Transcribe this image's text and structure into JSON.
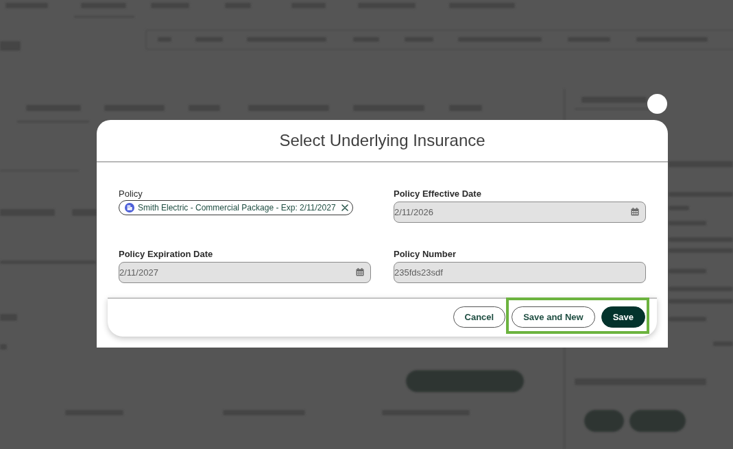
{
  "dialog": {
    "title": "Select Underlying Insurance",
    "fields": [
      {
        "kind": "chip",
        "label": "Policy",
        "value": "Smith Electric - Commercial Package - Exp: 2/11/2027"
      },
      {
        "kind": "date",
        "label": "Policy Effective Date",
        "value": "2/11/2026"
      },
      {
        "kind": "date",
        "label": "Policy Expiration Date",
        "value": "2/11/2027"
      },
      {
        "kind": "text",
        "label": "Policy Number",
        "value": "235fds23sdf"
      }
    ],
    "buttons": [
      {
        "label": "Cancel",
        "kind": "outline",
        "highlighted": false
      },
      {
        "label": "Save and New",
        "kind": "outline",
        "highlighted": true
      },
      {
        "label": "Save",
        "kind": "primary",
        "highlighted": true
      }
    ]
  }
}
